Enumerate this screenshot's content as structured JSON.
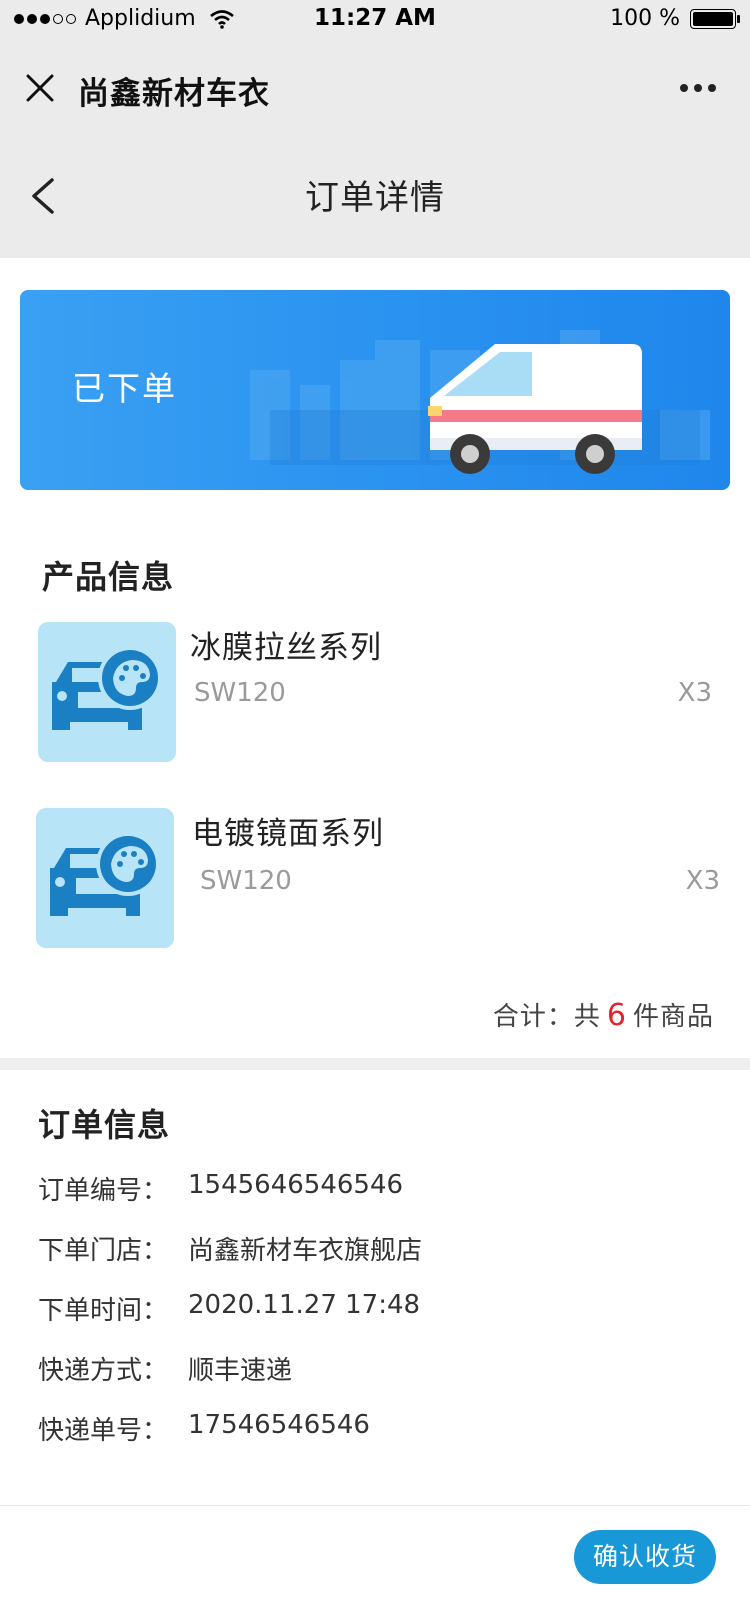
{
  "status_bar": {
    "carrier": "Applidium",
    "time": "11:27 AM",
    "battery": "100 %"
  },
  "miniapp": {
    "title": "尚鑫新材车衣"
  },
  "nav": {
    "title": "订单详情"
  },
  "banner": {
    "status": "已下单"
  },
  "products": {
    "section_title": "产品信息",
    "items": [
      {
        "name": "冰膜拉丝系列",
        "sku": "SW120",
        "qty": "X3"
      },
      {
        "name": "电镀镜面系列",
        "sku": "SW120",
        "qty": "X3"
      }
    ],
    "total": {
      "prefix": "合计：共",
      "count": "6",
      "suffix": "件商品"
    }
  },
  "order_info": {
    "section_title": "订单信息",
    "rows": [
      {
        "label": "订单编号：",
        "value": "1545646546546"
      },
      {
        "label": "下单门店：",
        "value": "尚鑫新材车衣旗舰店"
      },
      {
        "label": "下单时间：",
        "value": "2020.11.27 17:48"
      },
      {
        "label": "快递方式：",
        "value": "顺丰速递"
      },
      {
        "label": "快递单号：",
        "value": "17546546546"
      }
    ]
  },
  "actions": {
    "confirm_label": "确认收货"
  },
  "colors": {
    "accent": "#1998d7",
    "banner": "#2b93f0",
    "highlight": "#e6222a"
  },
  "icons": [
    "signal-dots-icon",
    "wifi-icon",
    "battery-icon",
    "close-icon",
    "more-icon",
    "back-icon",
    "van-icon",
    "car-palette-icon"
  ]
}
